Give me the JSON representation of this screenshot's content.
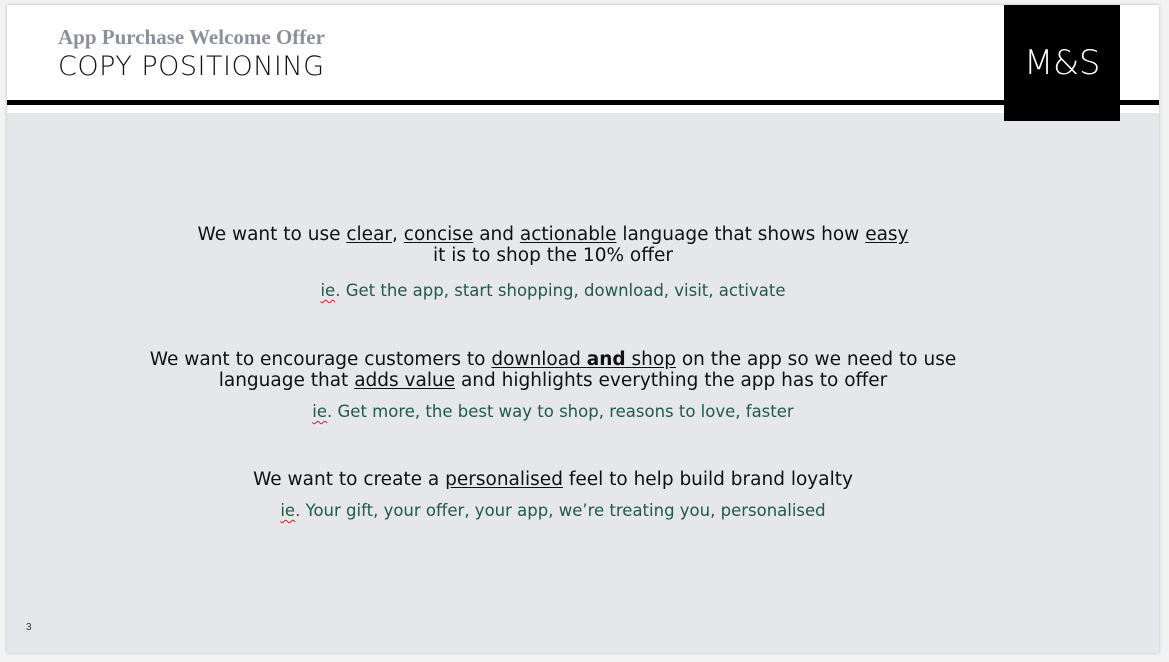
{
  "header": {
    "subtitle": "App Purchase Welcome Offer",
    "title": "COPY POSITIONING",
    "logo_text": "M&S"
  },
  "blocks": [
    {
      "statement": {
        "p1": "We want to use ",
        "u1": "clear",
        "p2": ", ",
        "u2": "concise",
        "p3": " and ",
        "u3": "actionable",
        "p4": " language that shows how ",
        "u4": "easy",
        "line2": "it is to shop the 10% offer"
      },
      "example": {
        "prefix": "ie",
        "text": ". Get the app, start shopping, download, visit, activate"
      }
    },
    {
      "statement": {
        "p1": "We want to encourage customers to ",
        "u1a": "download ",
        "u1b": "and",
        "u1c": " shop",
        "p2": " on the app so we need to use",
        "l2a": "language that ",
        "u2": "adds value",
        "l2b": " and highlights everything the app has to offer"
      },
      "example": {
        "prefix": "ie",
        "text": ". Get more, the best way to shop, reasons to love, faster"
      }
    },
    {
      "statement": {
        "p1": "We want to create a ",
        "u1": "personalised",
        "p2": " feel to help build brand loyalty"
      },
      "example": {
        "prefix": "ie",
        "text": ". Your gift, your offer, your app, we’re treating you, personalised"
      }
    }
  ],
  "footer": {
    "page_number": "3"
  },
  "colors": {
    "background": "#e6e7ea",
    "header_bg": "#ffffff",
    "rule": "#000000",
    "subtitle": "#8c909a",
    "example_text": "#1f5a4a",
    "spellcheck": "#d02020"
  }
}
